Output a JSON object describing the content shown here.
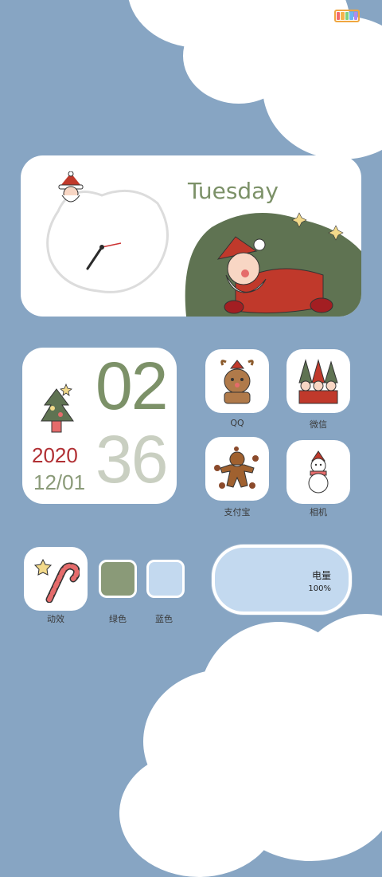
{
  "status_bar": {
    "signal_icon": "signal-icon",
    "wifi_icon": "wifi-icon",
    "battery_icon": "battery-icon"
  },
  "clock_widget": {
    "weekday": "Tuesday",
    "clock_icon": "analog-clock-icon"
  },
  "date_widget": {
    "hour": "02",
    "minute": "36",
    "year": "2020",
    "month_day": "12/01"
  },
  "apps": [
    {
      "label": "QQ",
      "icon": "reindeer-icon"
    },
    {
      "label": "微信",
      "icon": "elves-icon"
    },
    {
      "label": "支付宝",
      "icon": "gingerbread-icon"
    },
    {
      "label": "相机",
      "icon": "snowman-icon"
    }
  ],
  "dock": {
    "dynamic": {
      "label": "动效",
      "icon": "candy-cane-icon"
    },
    "green": {
      "label": "绿色",
      "color": "#8a9a78"
    },
    "blue": {
      "label": "蓝色",
      "color": "#c3d9ef"
    }
  },
  "battery_widget": {
    "label": "电量",
    "value": "100%"
  },
  "colors": {
    "background": "#87a5c3",
    "accent_green": "#7c9168",
    "accent_red": "#b13034"
  }
}
